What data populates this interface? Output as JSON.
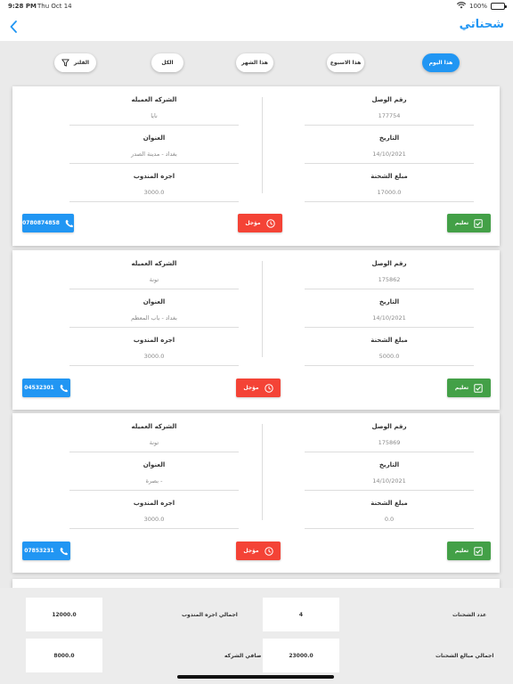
{
  "status": {
    "time": "9:28 PM",
    "date": "Thu Oct 14",
    "battery": "100%"
  },
  "nav": {
    "title": "شحناتي"
  },
  "filters": [
    {
      "label": "هذا اليوم",
      "active": true
    },
    {
      "label": "هذا الاسبوع",
      "active": false
    },
    {
      "label": "هذا الشهر",
      "active": false
    },
    {
      "label": "الكل",
      "active": false
    },
    {
      "label": "الفلتر",
      "active": false
    }
  ],
  "labels": {
    "receipt": "رقم الوصل",
    "date": "التاريخ",
    "amount": "مبلغ الشحنة",
    "client": "الشركه العميله",
    "address": "العنوان",
    "fee": "اجره المندوب",
    "deliver": "تعليم",
    "postpone": "مؤجل"
  },
  "cards": [
    {
      "receipt": "177754",
      "date": "14/10/2021",
      "amount": "17000.0",
      "client": "نايا",
      "address": "بغداد  -  مدينة الصدر",
      "fee": "3000.0",
      "phone": "0780874858"
    },
    {
      "receipt": "175862",
      "date": "14/10/2021",
      "amount": "5000.0",
      "client": "تونة",
      "address": "بغداد  -  باب المعظم",
      "fee": "3000.0",
      "phone": "04532301"
    },
    {
      "receipt": "175869",
      "date": "14/10/2021",
      "amount": "0.0",
      "client": "تونة",
      "address": "بصرة  -",
      "fee": "3000.0",
      "phone": "07853231"
    }
  ],
  "summary": {
    "count_label": "عدد الشحنات",
    "count_value": "4",
    "fees_label": "اجمالي اجره المندوب",
    "fees_value": "12000.0",
    "total_label": "اجمالي مبالغ الشحنات",
    "total_value": "23000.0",
    "net_label": "صافي الشركه",
    "net_value": "8000.0"
  },
  "colors": {
    "accent": "#2196f3",
    "deliver": "#43a047",
    "postpone": "#f44336"
  }
}
